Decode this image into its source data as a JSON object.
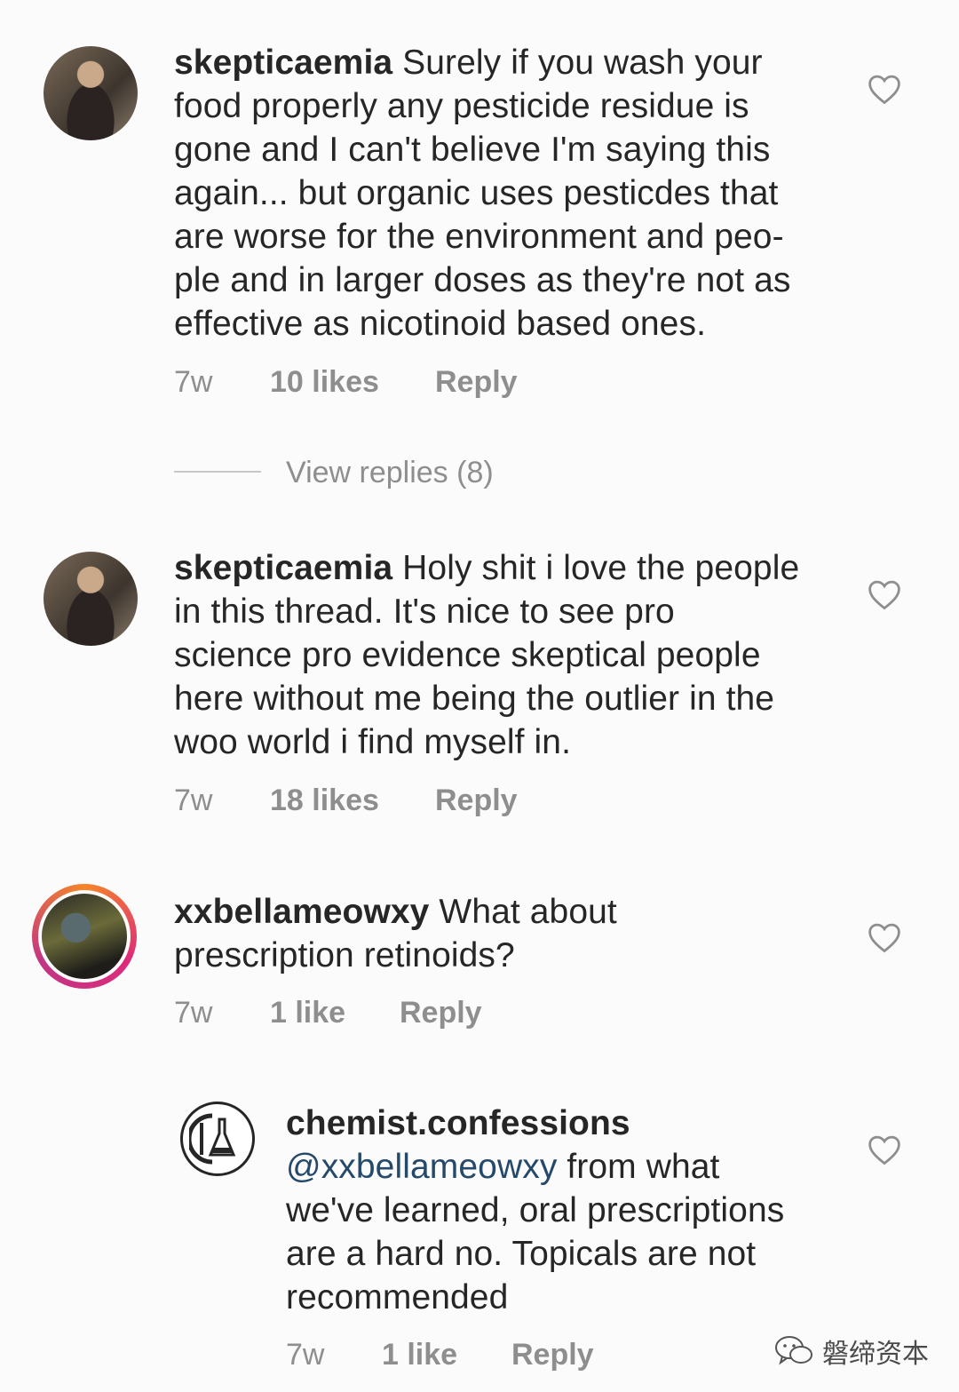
{
  "comments": [
    {
      "username": "skepticaemia",
      "text": " Surely if you wash your food properly any pesticide residue is gone and I can't believe I'm saying this again... but organic uses pesticdes that are worse for the environment and peo-ple and in larger doses as they're not as effective as nicotinoid based ones.",
      "lines": [
        "Surely if you wash your",
        "food properly any pesticide residue is",
        "gone and I can't believe I'm saying this",
        "again... but organic uses pesticdes that",
        "are worse for the environment and peo-",
        "ple and in larger doses as they're not as",
        "effective as nicotinoid based ones."
      ],
      "time": "7w",
      "likes": "10 likes",
      "reply": "Reply"
    },
    {
      "username": "skepticaemia",
      "lines": [
        "Holy shit i love the people",
        "in this thread. It's nice to see pro",
        "science pro evidence skeptical people",
        "here without me being the outlier in the",
        "woo world i find myself in."
      ],
      "time": "7w",
      "likes": "18 likes",
      "reply": "Reply"
    },
    {
      "username": "xxbellameowxy",
      "lines": [
        "What about",
        "prescription retinoids?"
      ],
      "time": "7w",
      "likes": "1 like",
      "reply": "Reply"
    },
    {
      "username": "chemist.confessions",
      "mention": "@xxbellameowxy",
      "lines": [
        "from what",
        "we've learned, oral prescriptions",
        "are a hard no. Topicals are not",
        "recommended"
      ],
      "time": "7w",
      "likes": "1 like",
      "reply": "Reply"
    }
  ],
  "view_replies": "View replies (8)",
  "watermark": "磐缔资本",
  "icons": {
    "like": "heart-outline-icon",
    "watermark": "wechat-icon"
  }
}
